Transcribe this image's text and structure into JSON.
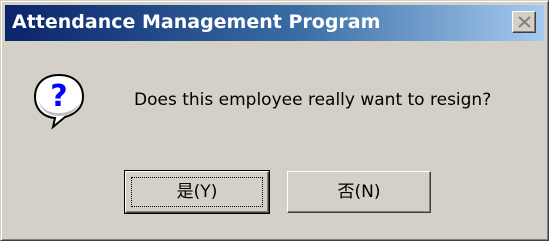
{
  "window": {
    "title": "Attendance Management Program",
    "close_icon": "close-icon"
  },
  "dialog": {
    "icon": "question-icon",
    "icon_glyph": "?",
    "message": "Does this employee really want to resign?"
  },
  "buttons": {
    "yes_label": "是(Y)",
    "no_label": "否(N)"
  },
  "colors": {
    "title_start": "#0a246a",
    "title_end": "#a6caf0",
    "face": "#d4d0c8",
    "icon_glyph": "#0000ff"
  }
}
